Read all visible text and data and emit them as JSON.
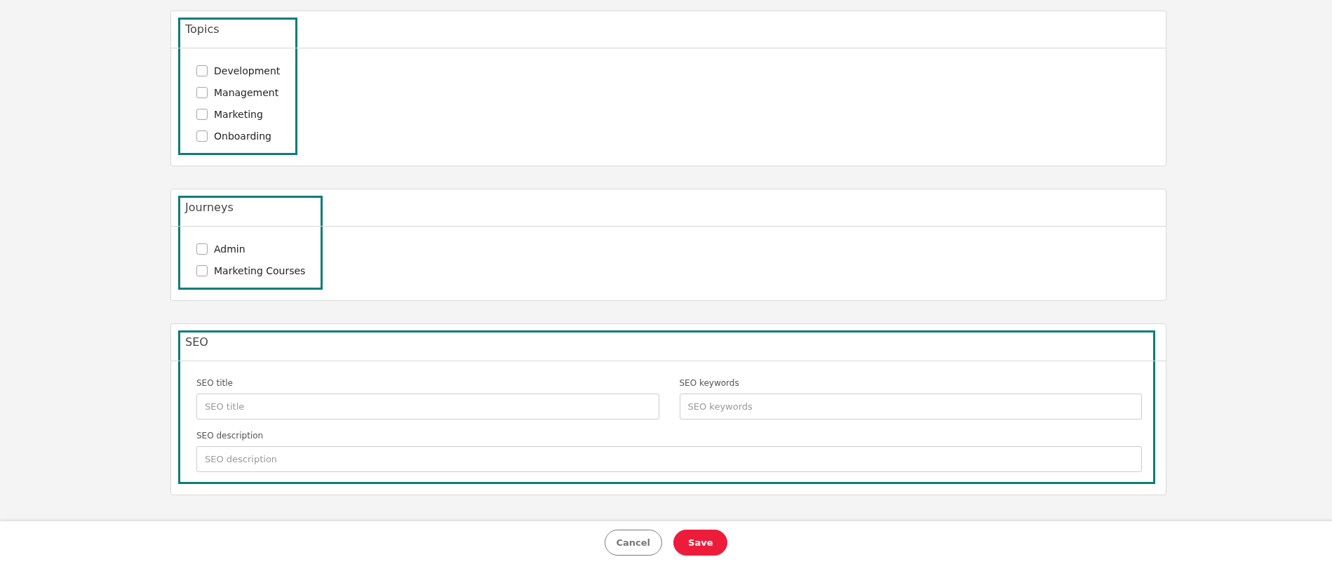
{
  "sections": [
    {
      "kind": "checkboxes",
      "title": "Topics",
      "highlighted": true,
      "options": [
        {
          "label": "Development",
          "checked": false
        },
        {
          "label": "Management",
          "checked": false
        },
        {
          "label": "Marketing",
          "checked": false
        },
        {
          "label": "Onboarding",
          "checked": false
        }
      ]
    },
    {
      "kind": "checkboxes",
      "title": "Journeys",
      "highlighted": true,
      "options": [
        {
          "label": "Admin",
          "checked": false
        },
        {
          "label": "Marketing Courses",
          "checked": false
        }
      ]
    },
    {
      "kind": "fields",
      "title": "SEO",
      "highlighted": true,
      "fields": [
        {
          "label": "SEO title",
          "placeholder": "SEO title",
          "kind": "half"
        },
        {
          "label": "SEO keywords",
          "placeholder": "SEO keywords",
          "kind": "half"
        },
        {
          "label": "SEO description",
          "placeholder": "SEO description",
          "kind": "full"
        }
      ]
    }
  ],
  "footer": {
    "buttons": [
      {
        "label": "Cancel",
        "kind": "secondary"
      },
      {
        "label": "Save",
        "kind": "primary"
      }
    ]
  }
}
